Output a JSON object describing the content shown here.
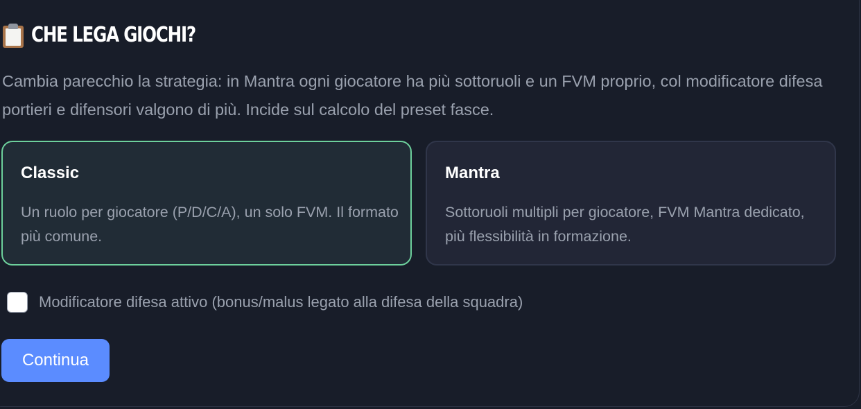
{
  "header": {
    "icon": "clipboard-icon",
    "title": "CHE LEGA GIOCHI?"
  },
  "description": "Cambia parecchio la strategia: in Mantra ogni giocatore ha più sottoruoli e un FVM proprio, col modificatore difesa portieri e difensori valgono di più. Incide sul calcolo del preset fasce.",
  "options": [
    {
      "title": "Classic",
      "description": "Un ruolo per giocatore (P/D/C/A), un solo FVM. Il formato più comune.",
      "selected": true
    },
    {
      "title": "Mantra",
      "description": "Sottoruoli multipli per giocatore, FVM Mantra dedicato, più flessibilità in formazione.",
      "selected": false
    }
  ],
  "defense_modifier": {
    "label": "Modificatore difesa attivo (bonus/malus legato alla difesa della squadra)",
    "checked": false
  },
  "continue_label": "Continua",
  "colors": {
    "background": "#181d29",
    "selected_border": "#6dd09c",
    "accent": "#5b8cff",
    "text_muted": "#9aa1ae"
  }
}
